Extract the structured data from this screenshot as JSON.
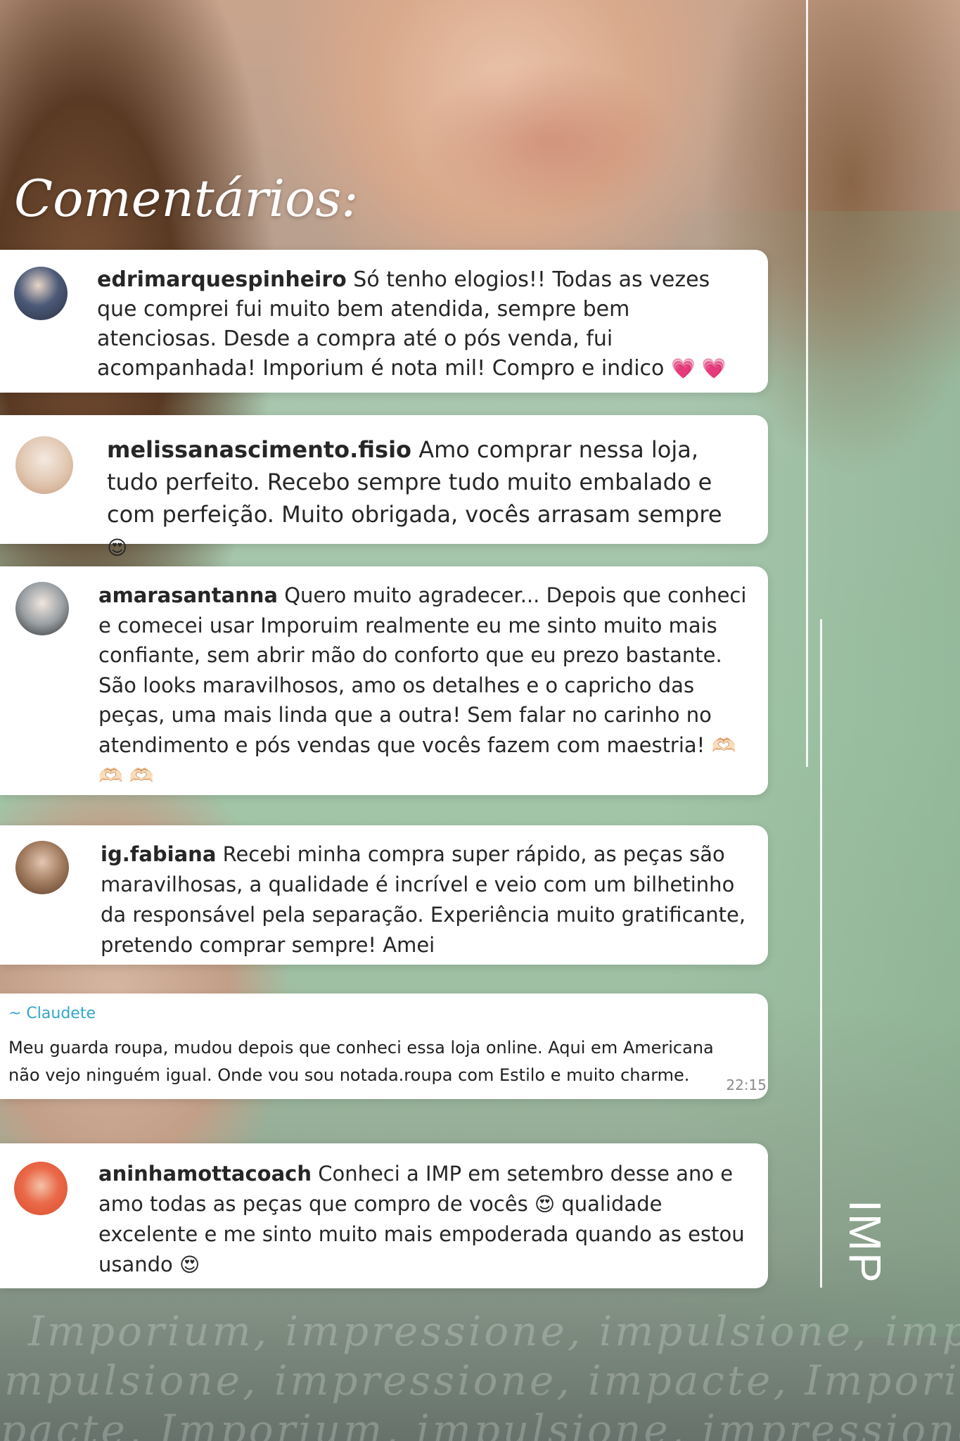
{
  "title": "Comentários:",
  "comments": [
    {
      "username": "edrimarquespinheiro",
      "text": " Só tenho elogios!! Todas as vezes que comprei fui muito bem atendida, sempre bem atenciosas. Desde a compra até o pós venda, fui acompanhada! Imporium é nota mil! Compro e indico",
      "emoji": "💗 💗"
    },
    {
      "username": "melissanascimento.fisio",
      "text": " Amo comprar nessa loja, tudo perfeito. Recebo sempre tudo muito embalado e com perfeição. Muito obrigada, vocês arrasam sempre",
      "emoji": "😍"
    },
    {
      "username": "amarasantanna",
      "text": " Quero muito agradecer... Depois que conheci e comecei usar Imporuim realmente eu me sinto muito mais confiante, sem abrir mão do conforto que eu prezo bastante. São looks maravilhosos, amo os detalhes e o capricho das peças, uma mais linda que a outra! Sem falar no carinho no atendimento e pós vendas que vocês fazem com maestria!",
      "emoji": "🫶🏻 🫶🏻 🫶🏻"
    },
    {
      "username": "ig.fabiana",
      "text": " Recebi minha compra super rápido, as peças são maravilhosas, a qualidade é incrível e veio com um bilhetinho da responsável pela separação. Experiência muito gratificante, pretendo comprar sempre! Amei",
      "emoji": ""
    },
    {
      "username": "aninhamottacoach",
      "text": " Conheci a IMP em setembro desse ano e amo todas as peças que compro de vocês",
      "emoji": "😍",
      "text2": " qualidade excelente e me sinto muito mais empoderada quando as estou usando",
      "emoji2": "😍"
    }
  ],
  "whatsapp": {
    "name": "~ Claudete",
    "message": "Meu guarda roupa, mudou depois que conheci essa loja online. Aqui em Americana não vejo ninguém igual. Onde vou sou notada.roupa com Estilo e muito charme.",
    "time": "22:15"
  },
  "brand": "IMP",
  "watermark_lines": [
    "Imporium, impressione, impulsione, impacte,",
    "mpulsione, impressione, impacte, Imporium,",
    "pacte, Imporium, impulsione, impressione, Im"
  ],
  "avatar_icons": [
    "avatar-1",
    "avatar-2",
    "avatar-3",
    "avatar-4",
    "avatar-5"
  ]
}
